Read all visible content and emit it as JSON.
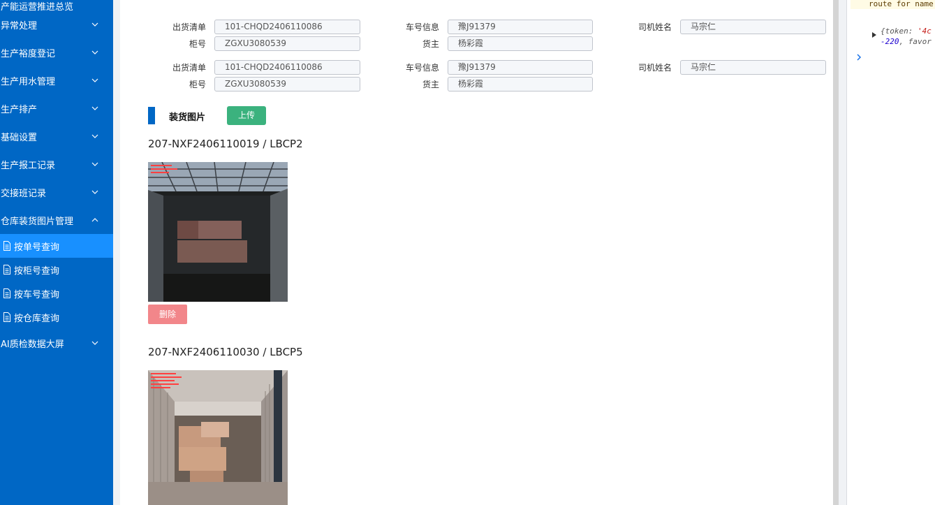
{
  "sidebar": {
    "items": [
      {
        "label": "产能运营推进总览"
      },
      {
        "label": "异常处理"
      },
      {
        "label": "生产裕度登记"
      },
      {
        "label": "生产用水管理"
      },
      {
        "label": "生产排产"
      },
      {
        "label": "基础设置"
      },
      {
        "label": "生产报工记录"
      },
      {
        "label": "交接班记录"
      },
      {
        "label": "仓库装货图片管理"
      },
      {
        "label": "AI质检数据大屏"
      }
    ],
    "sub_items": [
      {
        "label": "按单号查询",
        "active": true
      },
      {
        "label": "按柜号查询",
        "active": false
      },
      {
        "label": "按车号查询",
        "active": false
      },
      {
        "label": "按仓库查询",
        "active": false
      }
    ]
  },
  "labels": {
    "order": "出货清单",
    "vehicle": "车号信息",
    "driver": "司机姓名",
    "container": "柜号",
    "owner": "货主"
  },
  "records_form": [
    {
      "order": "101-CHQD2406110086",
      "vehicle": "豫J91379",
      "driver": "马宗仁",
      "container": "ZGXU3080539",
      "owner": "杨彩霞"
    },
    {
      "order": "101-CHQD2406110086",
      "vehicle": "豫J91379",
      "driver": "马宗仁",
      "container": "ZGXU3080539",
      "owner": "杨彩霞"
    }
  ],
  "section": {
    "title": "装货图片",
    "upload_label": "上传"
  },
  "photos": [
    {
      "title": "207-NXF2406110019 / LBCP2",
      "delete_label": "删除"
    },
    {
      "title": "207-NXF2406110030 / LBCP5",
      "delete_label": "删除"
    }
  ],
  "devtools": {
    "warning": "route for name",
    "obj_line1_key": "{token: ",
    "obj_line1_val": "'4c",
    "obj_line2_num": "-220",
    "obj_line2_rest": ", favor"
  },
  "colors": {
    "sidebar_bg": "#0067c5",
    "active_item": "#1890ff",
    "upload_btn": "#3bb27e",
    "delete_btn": "#f2868a"
  }
}
